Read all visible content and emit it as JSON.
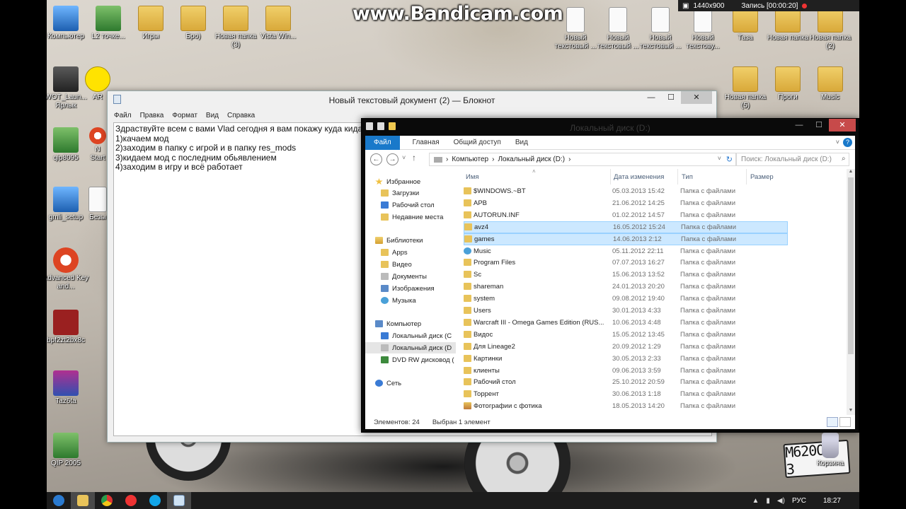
{
  "recorder": {
    "watermark": "www.Bandicam.com",
    "resolution": "1440x900",
    "recording": "Запись [00:00:20]"
  },
  "desktop": {
    "icons": [
      {
        "label": "Компьютер",
        "glyph": "computer-icon"
      },
      {
        "label": "L2 точке...",
        "glyph": "shortcut-icon"
      },
      {
        "label": "Игры",
        "glyph": "folder-icon"
      },
      {
        "label": "Бро)",
        "glyph": "folder-icon"
      },
      {
        "label": "Новая папка (3)",
        "glyph": "folder-icon"
      },
      {
        "label": "Vista Win...",
        "glyph": "folder-icon"
      },
      {
        "label": "Новый текстовый ...",
        "glyph": "text-file-icon"
      },
      {
        "label": "Новый текстовый ...",
        "glyph": "text-file-icon"
      },
      {
        "label": "Новый текстовый ...",
        "glyph": "text-file-icon"
      },
      {
        "label": "Новый текстову...",
        "glyph": "text-file-icon"
      },
      {
        "label": "Таза",
        "glyph": "folder-icon"
      },
      {
        "label": "Новая папка",
        "glyph": "folder-icon"
      },
      {
        "label": "Новая папка (2)",
        "glyph": "folder-icon"
      },
      {
        "label": "WOT_Laun... Ярлык",
        "glyph": "tank-icon"
      },
      {
        "label": "AR",
        "glyph": "smiley-icon"
      },
      {
        "label": "Новая папка (5)",
        "glyph": "folder-icon"
      },
      {
        "label": "Проги",
        "glyph": "folder-icon"
      },
      {
        "label": "Music",
        "glyph": "folder-icon"
      },
      {
        "label": "qip8095",
        "glyph": "qip-icon"
      },
      {
        "label": "N Start",
        "glyph": "app-icon"
      },
      {
        "label": "gmli_setup",
        "glyph": "setup-icon"
      },
      {
        "label": "Безы",
        "glyph": "text-file-icon"
      },
      {
        "label": "Advanced Key and...",
        "glyph": "advanced-key-icon"
      },
      {
        "label": "bpf2zt2bx8c",
        "glyph": "book-icon"
      },
      {
        "label": "Taz6ta",
        "glyph": "winrar-icon"
      },
      {
        "label": "QIP 2005",
        "glyph": "qip-icon"
      },
      {
        "label": "Корзина",
        "glyph": "recycle-bin-icon"
      }
    ],
    "plate": "М620ОЕ 3"
  },
  "notepad": {
    "title": "Новый текстовый документ (2) — Блокнот",
    "menu": [
      "Файл",
      "Правка",
      "Формат",
      "Вид",
      "Справка"
    ],
    "content": "Здраствуйте всем с вами Vlad сегодня я вам покажу куда кидат\n1)качаем мод\n2)заходим в папку с игрой и в папку res_mods\n3)кидаем мод с последним обьявлением\n4)заходим в игру и всё работает",
    "buttons": {
      "minimize": "—",
      "maximize": "☐",
      "close": "✕"
    }
  },
  "explorer": {
    "title": "Локальный диск (D:)",
    "ribbon_tabs": [
      "Файл",
      "Главная",
      "Общий доступ",
      "Вид"
    ],
    "help": "?",
    "address": [
      "Компьютер",
      "Локальный диск (D:)"
    ],
    "search_placeholder": "Поиск: Локальный диск (D:)",
    "nav": {
      "favorites": "Избранное",
      "favorites_items": [
        "Загрузки",
        "Рабочий стол",
        "Недавние места"
      ],
      "libraries": "Библиотеки",
      "libraries_items": [
        "Apps",
        "Видео",
        "Документы",
        "Изображения",
        "Музыка"
      ],
      "computer": "Компьютер",
      "computer_items": [
        "Локальный диск (C",
        "Локальный диск (D",
        "DVD RW дисковод ("
      ],
      "network": "Сеть"
    },
    "columns": {
      "name": "Имя",
      "date": "Дата изменения",
      "type": "Тип",
      "size": "Размер"
    },
    "files": [
      {
        "name": "$WINDOWS.~BT",
        "date": "05.03.2013 15:42",
        "type": "Папка с файлами",
        "selected": false,
        "icon": "folder"
      },
      {
        "name": "APB",
        "date": "21.06.2012 14:25",
        "type": "Папка с файлами",
        "selected": false,
        "icon": "folder"
      },
      {
        "name": "AUTORUN.INF",
        "date": "01.02.2012 14:57",
        "type": "Папка с файлами",
        "selected": false,
        "icon": "folder"
      },
      {
        "name": "avz4",
        "date": "16.05.2012 15:24",
        "type": "Папка с файлами",
        "selected": true,
        "icon": "folder"
      },
      {
        "name": "games",
        "date": "14.06.2013 2:12",
        "type": "Папка с файлами",
        "selected": true,
        "icon": "folder"
      },
      {
        "name": "Music",
        "date": "05.11.2012 22:11",
        "type": "Папка с файлами",
        "selected": false,
        "icon": "music"
      },
      {
        "name": "Program Files",
        "date": "07.07.2013 16:27",
        "type": "Папка с файлами",
        "selected": false,
        "icon": "folder"
      },
      {
        "name": "Sc",
        "date": "15.06.2013 13:52",
        "type": "Папка с файлами",
        "selected": false,
        "icon": "folder"
      },
      {
        "name": "shareman",
        "date": "24.01.2013 20:20",
        "type": "Папка с файлами",
        "selected": false,
        "icon": "folder"
      },
      {
        "name": "system",
        "date": "09.08.2012 19:40",
        "type": "Папка с файлами",
        "selected": false,
        "icon": "folder"
      },
      {
        "name": "Users",
        "date": "30.01.2013 4:33",
        "type": "Папка с файлами",
        "selected": false,
        "icon": "folder"
      },
      {
        "name": "Warcraft III - Omega Games Edition (RUS...",
        "date": "10.06.2013 4:48",
        "type": "Папка с файлами",
        "selected": false,
        "icon": "folder"
      },
      {
        "name": "Видос",
        "date": "15.05.2012 13:45",
        "type": "Папка с файлами",
        "selected": false,
        "icon": "folder"
      },
      {
        "name": "Для Lineage2",
        "date": "20.09.2012 1:29",
        "type": "Папка с файлами",
        "selected": false,
        "icon": "folder"
      },
      {
        "name": "Картинки",
        "date": "30.05.2013 2:33",
        "type": "Папка с файлами",
        "selected": false,
        "icon": "folder"
      },
      {
        "name": "клиенты",
        "date": "09.06.2013 3:59",
        "type": "Папка с файлами",
        "selected": false,
        "icon": "folder"
      },
      {
        "name": "Рабочий стол",
        "date": "25.10.2012 20:59",
        "type": "Папка с файлами",
        "selected": false,
        "icon": "folder"
      },
      {
        "name": "Торрент",
        "date": "30.06.2013 1:18",
        "type": "Папка с файлами",
        "selected": false,
        "icon": "folder"
      },
      {
        "name": "Фотографии с фотика",
        "date": "18.05.2013 14:20",
        "type": "Папка с файлами",
        "selected": false,
        "icon": "photo"
      }
    ],
    "status": {
      "count": "Элементов: 24",
      "selected": "Выбран 1 элемент"
    }
  },
  "taskbar": {
    "items": [
      "ie-icon",
      "explorer-icon",
      "chrome-icon",
      "yandex-icon",
      "skype-icon",
      "notepad-icon"
    ],
    "language": "РУС",
    "time": "18:27"
  },
  "colors": {
    "accent": "#1979ca",
    "selection": "#cce8ff",
    "close_red": "#c74a4a"
  }
}
